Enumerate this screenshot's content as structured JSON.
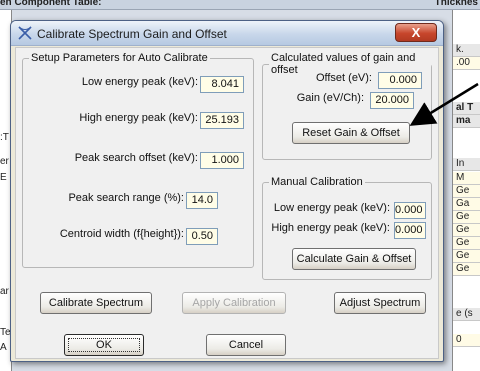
{
  "background": {
    "title_left": "en Component Table:",
    "title_right": "Thicknes",
    "right_col": [
      "k.",
      ".00",
      "al T",
      "ma",
      "In",
      "M",
      "Ge",
      "Ga",
      "Ge",
      "Ge",
      "Ge",
      "Ge",
      "Ge",
      "e (s",
      "0"
    ],
    "left_col": [
      ":T",
      "er",
      "E",
      "ar",
      "Te",
      "A"
    ]
  },
  "dialog": {
    "title": "Calibrate Spectrum Gain and Offset",
    "close_label": "X",
    "setup": {
      "legend": "Setup Parameters for Auto Calibrate",
      "fields": [
        {
          "label": "Low energy peak (keV):",
          "value": "8.041"
        },
        {
          "label": "High energy peak (keV):",
          "value": "25.193"
        },
        {
          "label": "Peak search offset (keV):",
          "value": "1.000"
        },
        {
          "label": "Peak search range (%):",
          "value": "14.0"
        },
        {
          "label": "Centroid width (f{height}):",
          "value": "0.50"
        }
      ]
    },
    "calculated": {
      "legend": "Calculated values of gain and offset",
      "offset_label": "Offset (eV):",
      "offset_value": "0.000",
      "gain_label": "Gain (eV/Ch):",
      "gain_value": "20.000",
      "reset_button": "Reset Gain & Offset"
    },
    "manual": {
      "legend": "Manual Calibration",
      "low_label": "Low energy peak (keV):",
      "low_value": "0.000",
      "high_label": "High energy peak (keV):",
      "high_value": "0.000",
      "calculate_button": "Calculate Gain & Offset"
    },
    "buttons": {
      "calibrate": "Calibrate Spectrum",
      "apply": "Apply Calibration",
      "adjust": "Adjust Spectrum",
      "ok": "OK",
      "cancel": "Cancel"
    }
  },
  "colors": {
    "arrow": "#000000",
    "close_button": "#c7462c",
    "input_background": "#fffde7"
  }
}
